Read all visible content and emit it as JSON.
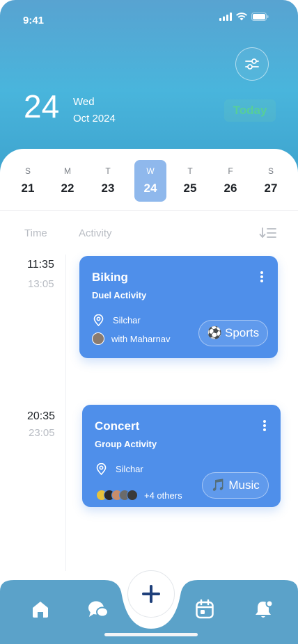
{
  "status_bar": {
    "time": "9:41"
  },
  "header": {
    "day_number": "24",
    "weekday": "Wed",
    "month_year": "Oct 2024",
    "today_label": "Today"
  },
  "week": [
    {
      "letter": "S",
      "date": "21",
      "selected": false
    },
    {
      "letter": "M",
      "date": "22",
      "selected": false
    },
    {
      "letter": "T",
      "date": "23",
      "selected": false
    },
    {
      "letter": "W",
      "date": "24",
      "selected": true
    },
    {
      "letter": "T",
      "date": "25",
      "selected": false
    },
    {
      "letter": "F",
      "date": "26",
      "selected": false
    },
    {
      "letter": "S",
      "date": "27",
      "selected": false
    }
  ],
  "columns": {
    "time": "Time",
    "activity": "Activity"
  },
  "events": [
    {
      "start": "11:35",
      "end": "13:05",
      "title": "Biking",
      "subtitle": "Duel Activity",
      "location": "Silchar",
      "people": "with Maharnav",
      "tag_emoji": "⚽",
      "tag": "Sports"
    },
    {
      "start": "20:35",
      "end": "23:05",
      "title": "Concert",
      "subtitle": "Group Activity",
      "location": "Silchar",
      "people": "+4 others",
      "tag_emoji": "🎵",
      "tag": "Music"
    }
  ],
  "icons": {
    "filter": "sliders-icon",
    "sort": "sort-icon",
    "home": "home-icon",
    "chat": "chat-icon",
    "add": "plus-icon",
    "calendar": "calendar-icon",
    "notifications": "bell-icon"
  },
  "colors": {
    "header": "#49b5dc",
    "card": "#4f8fea",
    "selected_day": "#8fb8ec",
    "navbar": "#5ba2c9",
    "fab_plus": "#1e3f7a"
  }
}
